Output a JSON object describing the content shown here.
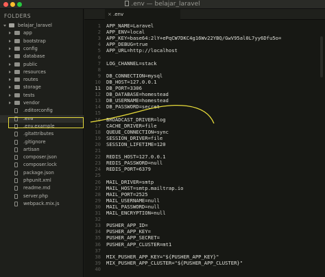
{
  "window": {
    "title": ".env — belajar_laravel"
  },
  "sidebar": {
    "heading": "FOLDERS",
    "root": "belajar_laravel",
    "folders": [
      "app",
      "bootstrap",
      "config",
      "database",
      "public",
      "resources",
      "routes",
      "storage",
      "tests",
      "vendor"
    ],
    "files": [
      ".editorconfig",
      ".env",
      ".env.example",
      ".gitattributes",
      ".gitignore",
      "artisan",
      "composer.json",
      "composer.lock",
      "package.json",
      "phpunit.xml",
      "readme.md",
      "server.php",
      "webpack.mix.js"
    ],
    "selected_file": ".env"
  },
  "tab": {
    "label": ".env",
    "close_glyph": "×"
  },
  "editor": {
    "current_line": "11",
    "lines": [
      {
        "n": "1",
        "t": "APP_NAME=Laravel"
      },
      {
        "n": "2",
        "t": "APP_ENV=local"
      },
      {
        "n": "3",
        "t": "APP_KEY=base64:2lY+ePqCW7DKC4g16Wv22YBQ/GwV95al0L7yy6Dfu5o="
      },
      {
        "n": "4",
        "t": "APP_DEBUG=true"
      },
      {
        "n": "5",
        "t": "APP_URL=http://localhost"
      },
      {
        "n": "6",
        "t": ""
      },
      {
        "n": "7",
        "t": "LOG_CHANNEL=stack"
      },
      {
        "n": "8",
        "t": ""
      },
      {
        "n": "9",
        "t": "DB_CONNECTION=mysql"
      },
      {
        "n": "10",
        "t": "DB_HOST=127.0.0.1"
      },
      {
        "n": "11",
        "t": "DB_PORT=3306"
      },
      {
        "n": "12",
        "t": "DB_DATABASE=homestead"
      },
      {
        "n": "13",
        "t": "DB_USERNAME=homestead"
      },
      {
        "n": "14",
        "t": "DB_PASSWORD=secret"
      },
      {
        "n": "15",
        "t": ""
      },
      {
        "n": "16",
        "t": "BROADCAST_DRIVER=log"
      },
      {
        "n": "17",
        "t": "CACHE_DRIVER=file"
      },
      {
        "n": "18",
        "t": "QUEUE_CONNECTION=sync"
      },
      {
        "n": "19",
        "t": "SESSION_DRIVER=file"
      },
      {
        "n": "20",
        "t": "SESSION_LIFETIME=120"
      },
      {
        "n": "21",
        "t": ""
      },
      {
        "n": "22",
        "t": "REDIS_HOST=127.0.0.1"
      },
      {
        "n": "23",
        "t": "REDIS_PASSWORD=null"
      },
      {
        "n": "24",
        "t": "REDIS_PORT=6379"
      },
      {
        "n": "25",
        "t": ""
      },
      {
        "n": "26",
        "t": "MAIL_DRIVER=smtp"
      },
      {
        "n": "27",
        "t": "MAIL_HOST=smtp.mailtrap.io"
      },
      {
        "n": "28",
        "t": "MAIL_PORT=2525"
      },
      {
        "n": "29",
        "t": "MAIL_USERNAME=null"
      },
      {
        "n": "30",
        "t": "MAIL_PASSWORD=null"
      },
      {
        "n": "31",
        "t": "MAIL_ENCRYPTION=null"
      },
      {
        "n": "32",
        "t": ""
      },
      {
        "n": "33",
        "t": "PUSHER_APP_ID="
      },
      {
        "n": "34",
        "t": "PUSHER_APP_KEY="
      },
      {
        "n": "35",
        "t": "PUSHER_APP_SECRET="
      },
      {
        "n": "36",
        "t": "PUSHER_APP_CLUSTER=mt1"
      },
      {
        "n": "37",
        "t": ""
      },
      {
        "n": "38",
        "t": "MIX_PUSHER_APP_KEY=\"${PUSHER_APP_KEY}\""
      },
      {
        "n": "39",
        "t": "MIX_PUSHER_APP_CLUSTER=\"${PUSHER_APP_CLUSTER}\""
      },
      {
        "n": "40",
        "t": ""
      }
    ]
  },
  "annotation": {
    "color": "#e8dc3a"
  }
}
